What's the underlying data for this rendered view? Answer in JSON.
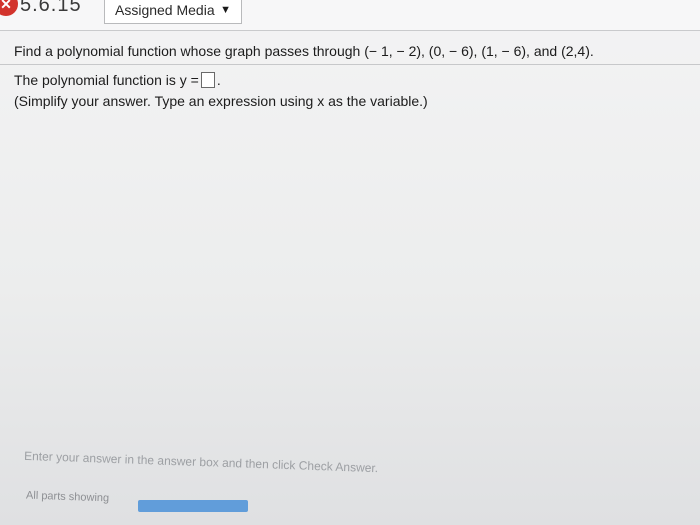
{
  "header": {
    "problem_number": "5.6.15",
    "status_icon": "incorrect-x-icon",
    "status_color": "#d2332c",
    "assigned_media_label": "Assigned Media",
    "caret_icon": "caret-down-icon"
  },
  "question": {
    "prompt": "Find a polynomial function whose graph passes through (− 1, − 2), (0, − 6), (1, − 6), and (2,4).",
    "answer_label": "The polynomial function is y =",
    "answer_value": "",
    "answer_suffix": ".",
    "hint": "(Simplify your answer. Type an expression using x as the variable.)"
  },
  "footer": {
    "instruction": "Enter your answer in the answer box and then click Check Answer.",
    "parts_label": "All parts showing",
    "progress": 1.0,
    "accent_color": "#4a90d8"
  }
}
